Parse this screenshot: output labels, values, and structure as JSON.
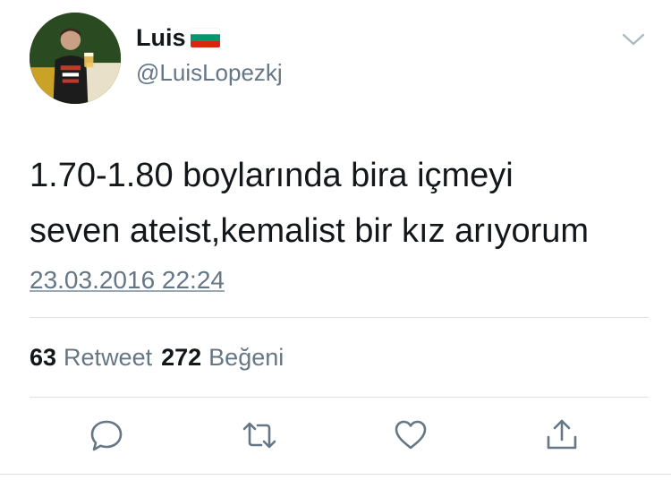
{
  "author": {
    "display_name": "Luis",
    "flag_icon": "bulgaria-flag-icon",
    "handle": "@LuisLopezkj"
  },
  "tweet": {
    "lines": [
      "1.70-1.80 boylarında bira içmeyi",
      "seven ateist,kemalist bir kız arıyorum"
    ],
    "timestamp": "23.03.2016 22:24"
  },
  "stats": {
    "retweets": {
      "count": "63",
      "label": "Retweet"
    },
    "likes": {
      "count": "272",
      "label": "Beğeni"
    }
  },
  "actions": [
    "reply-icon",
    "retweet-icon",
    "like-icon",
    "share-icon"
  ],
  "colors": {
    "text": "#14171a",
    "secondary": "#657786",
    "divider": "#dbe1e6",
    "flag_white": "#ffffff",
    "flag_green": "#00966e",
    "flag_red": "#d62612"
  }
}
